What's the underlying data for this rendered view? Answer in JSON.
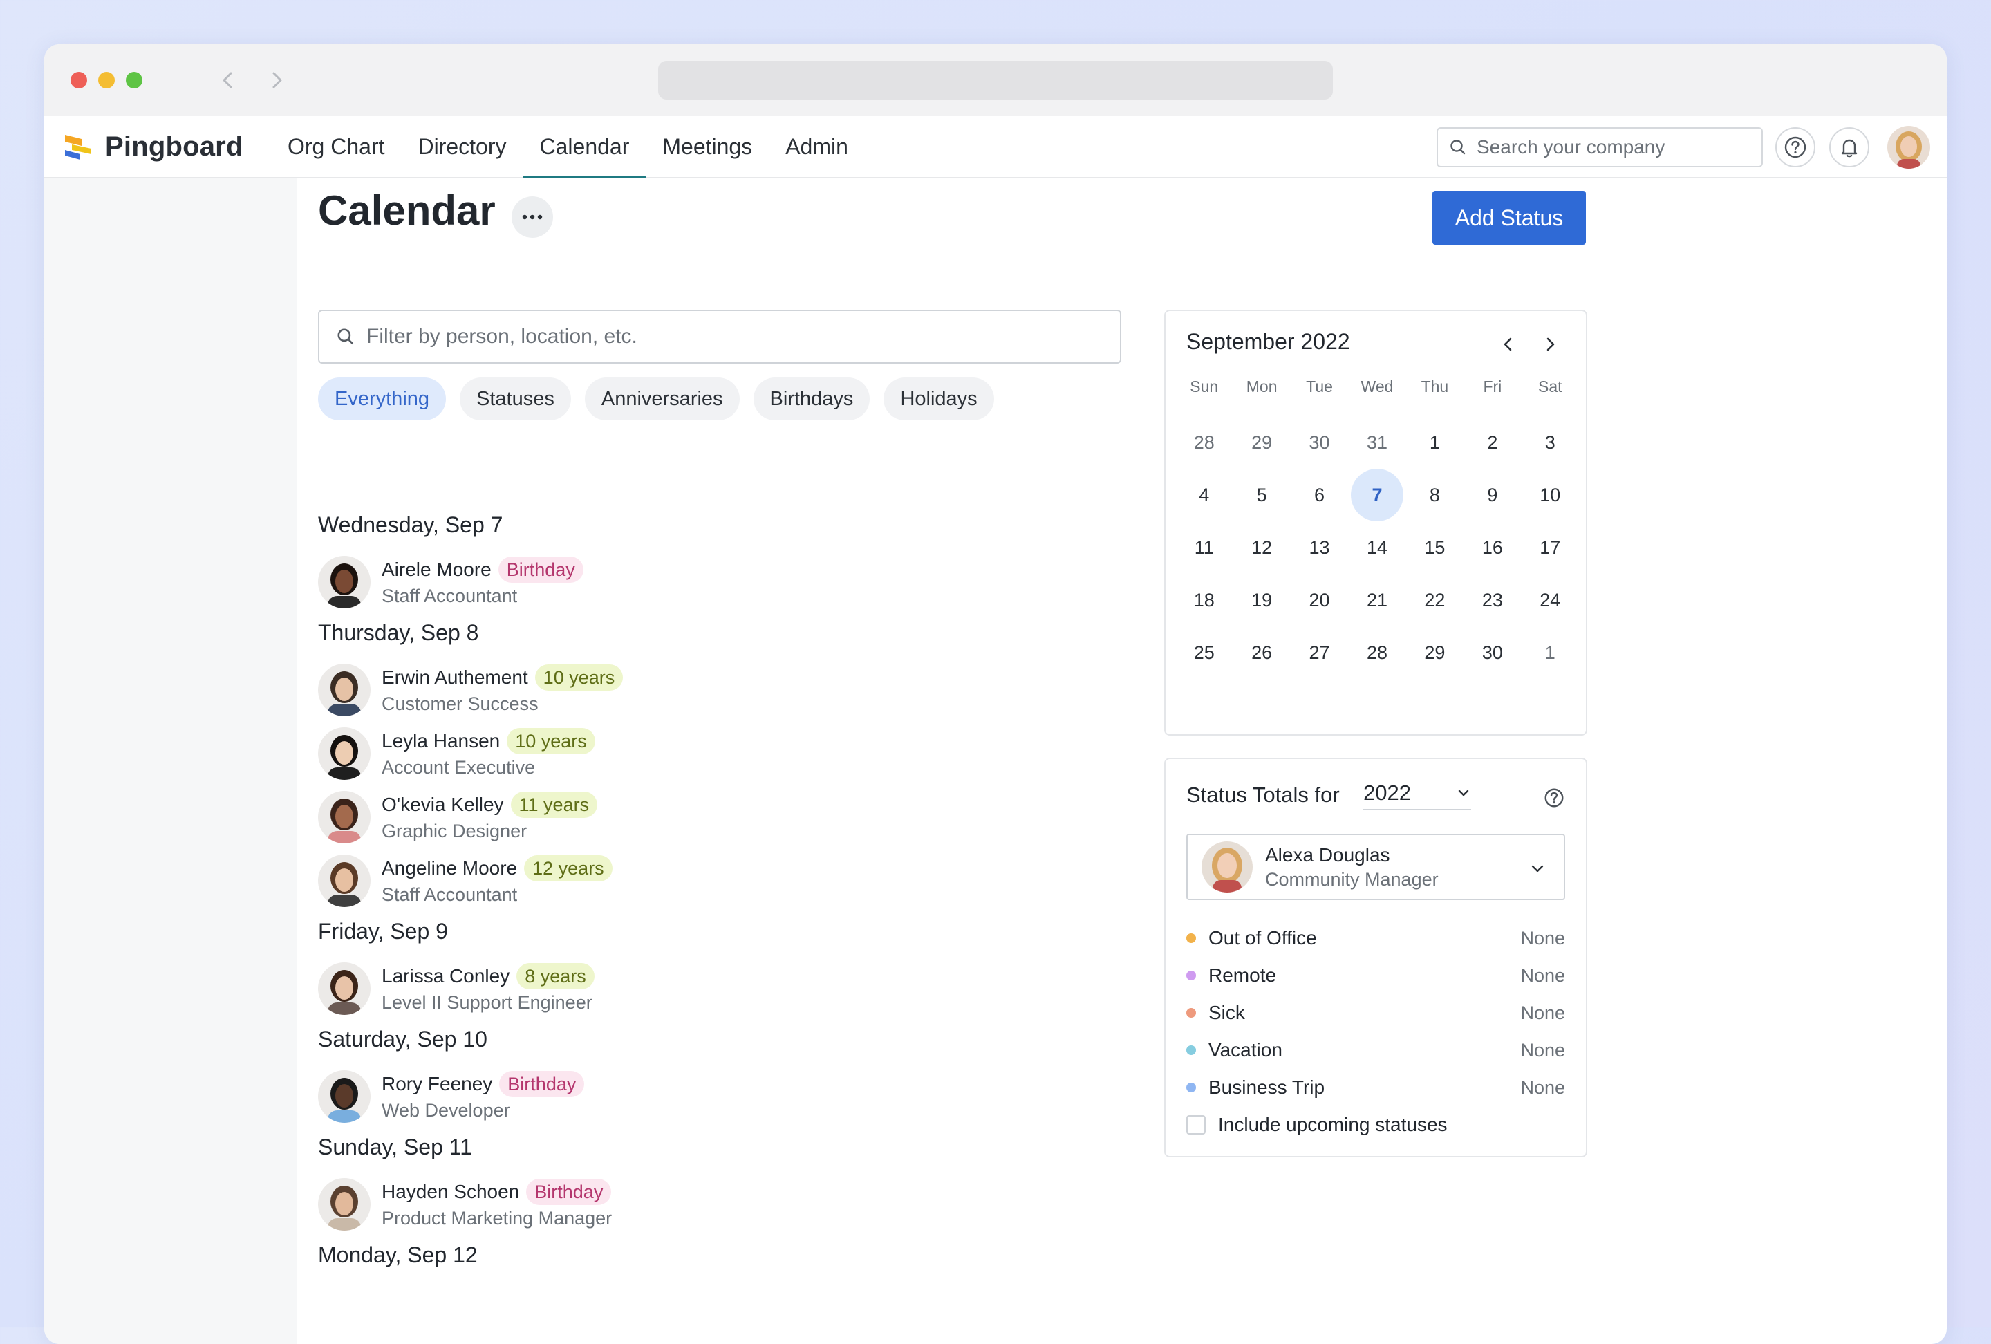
{
  "app": {
    "brand": "Pingboard",
    "nav": [
      "Org Chart",
      "Directory",
      "Calendar",
      "Meetings",
      "Admin"
    ],
    "active_nav": 2,
    "search_placeholder": "Search your company"
  },
  "page": {
    "title": "Calendar",
    "add_status_label": "Add Status",
    "filter_placeholder": "Filter by person, location, etc.",
    "chips": [
      "Everything",
      "Statuses",
      "Anniversaries",
      "Birthdays",
      "Holidays"
    ],
    "active_chip": 0
  },
  "events": [
    {
      "day": "Wednesday, Sep 7",
      "people": [
        {
          "name": "Airele Moore",
          "badge": "Birthday",
          "badge_type": "birthday",
          "role": "Staff Accountant",
          "skin": "#7a4a34",
          "hair": "#1b120e",
          "shirt": "#2a2a2a"
        }
      ]
    },
    {
      "day": "Thursday, Sep 8",
      "people": [
        {
          "name": "Erwin Authement",
          "badge": "10 years",
          "badge_type": "years",
          "role": "Customer Success",
          "skin": "#e6c2a6",
          "hair": "#3b2d24",
          "shirt": "#3b4a63"
        },
        {
          "name": "Leyla Hansen",
          "badge": "10 years",
          "badge_type": "years",
          "role": "Account Executive",
          "skin": "#edcdb2",
          "hair": "#15110f",
          "shirt": "#1f1f1f"
        },
        {
          "name": "O'kevia Kelley",
          "badge": "11 years",
          "badge_type": "years",
          "role": "Graphic Designer",
          "skin": "#a36a4d",
          "hair": "#3a231a",
          "shirt": "#d98a8a"
        },
        {
          "name": "Angeline Moore",
          "badge": "12 years",
          "badge_type": "years",
          "role": "Staff Accountant",
          "skin": "#e7c0a2",
          "hair": "#5a3a26",
          "shirt": "#3f3f3f"
        }
      ]
    },
    {
      "day": "Friday, Sep 9",
      "people": [
        {
          "name": "Larissa Conley",
          "badge": "8 years",
          "badge_type": "years",
          "role": "Level II Support Engineer",
          "skin": "#e8c3a8",
          "hair": "#3b2418",
          "shirt": "#6b5a54"
        }
      ]
    },
    {
      "day": "Saturday, Sep 10",
      "people": [
        {
          "name": "Rory Feeney",
          "badge": "Birthday",
          "badge_type": "birthday",
          "role": "Web Developer",
          "skin": "#5a3a2a",
          "hair": "#1a1a1a",
          "shirt": "#79aede"
        }
      ]
    },
    {
      "day": "Sunday, Sep 11",
      "people": [
        {
          "name": "Hayden Schoen",
          "badge": "Birthday",
          "badge_type": "birthday",
          "role": "Product Marketing Manager",
          "skin": "#e2b99b",
          "hair": "#5a4030",
          "shirt": "#c9b9a8"
        }
      ]
    },
    {
      "day": "Monday, Sep 12",
      "people": []
    }
  ],
  "mini_calendar": {
    "title": "September 2022",
    "weekdays": [
      "Sun",
      "Mon",
      "Tue",
      "Wed",
      "Thu",
      "Fri",
      "Sat"
    ],
    "days": [
      {
        "d": "28",
        "muted": true
      },
      {
        "d": "29",
        "muted": true
      },
      {
        "d": "30",
        "muted": true
      },
      {
        "d": "31",
        "muted": true
      },
      {
        "d": "1"
      },
      {
        "d": "2"
      },
      {
        "d": "3"
      },
      {
        "d": "4"
      },
      {
        "d": "5"
      },
      {
        "d": "6"
      },
      {
        "d": "7",
        "today": true
      },
      {
        "d": "8"
      },
      {
        "d": "9"
      },
      {
        "d": "10"
      },
      {
        "d": "11"
      },
      {
        "d": "12"
      },
      {
        "d": "13"
      },
      {
        "d": "14"
      },
      {
        "d": "15"
      },
      {
        "d": "16"
      },
      {
        "d": "17"
      },
      {
        "d": "18"
      },
      {
        "d": "19"
      },
      {
        "d": "20"
      },
      {
        "d": "21"
      },
      {
        "d": "22"
      },
      {
        "d": "23"
      },
      {
        "d": "24"
      },
      {
        "d": "25"
      },
      {
        "d": "26"
      },
      {
        "d": "27"
      },
      {
        "d": "28"
      },
      {
        "d": "29"
      },
      {
        "d": "30"
      },
      {
        "d": "1",
        "muted": true
      }
    ]
  },
  "status_totals": {
    "label": "Status Totals for",
    "year": "2022",
    "person": {
      "name": "Alexa Douglas",
      "role": "Community Manager"
    },
    "statuses": [
      {
        "name": "Out of Office",
        "value": "None",
        "color": "#f2b24b"
      },
      {
        "name": "Remote",
        "value": "None",
        "color": "#cf9bf0"
      },
      {
        "name": "Sick",
        "value": "None",
        "color": "#ee9a7d"
      },
      {
        "name": "Vacation",
        "value": "None",
        "color": "#86cde0"
      },
      {
        "name": "Business Trip",
        "value": "None",
        "color": "#8fb6f2"
      }
    ],
    "include_upcoming": "Include upcoming statuses"
  },
  "colors": {
    "accent": "#2f6ad6",
    "nav_underline": "#1f7a82",
    "today_bg": "#dbe8fb"
  }
}
